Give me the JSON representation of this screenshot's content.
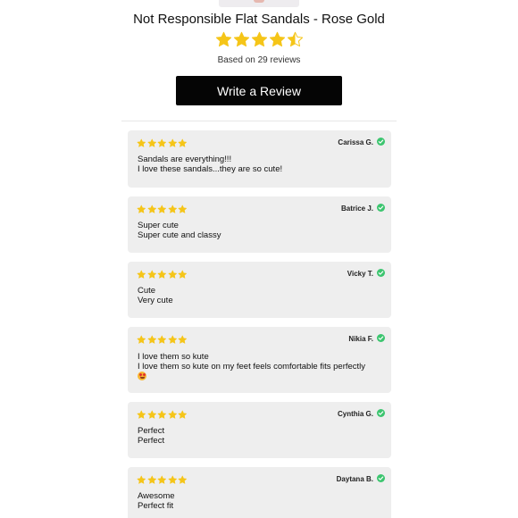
{
  "product": {
    "title": "Not Responsible Flat Sandals - Rose Gold",
    "rating": 4.5,
    "based_on": "Based on 29 reviews"
  },
  "actions": {
    "write_review_label": "Write a Review"
  },
  "colors": {
    "star": "#f5c518",
    "verified": "#3cc56f",
    "button_bg": "#050505",
    "card_bg": "#eeeeee"
  },
  "reviews": [
    {
      "author": "Carissa G.",
      "rating": 5,
      "title": "Sandals are everything!!!",
      "body": "I love these sandals...they are so cute!",
      "verified": true
    },
    {
      "author": "Batrice J.",
      "rating": 5,
      "title": "Super cute",
      "body": "Super cute and classy",
      "verified": true
    },
    {
      "author": "Vicky T.",
      "rating": 5,
      "title": "Cute",
      "body": "Very cute",
      "verified": true
    },
    {
      "author": "Nikia F.",
      "rating": 5,
      "title": "I love them so kute",
      "body": "I love them so kute on my feet feels comfortable fits perfectly",
      "emoji": "heart-eyes-emoji",
      "verified": true
    },
    {
      "author": "Cynthia G.",
      "rating": 5,
      "title": "Perfect",
      "body": "Perfect",
      "verified": true
    },
    {
      "author": "Daytana B.",
      "rating": 5,
      "title": "Awesome",
      "body": "Perfect fit",
      "verified": true
    }
  ]
}
